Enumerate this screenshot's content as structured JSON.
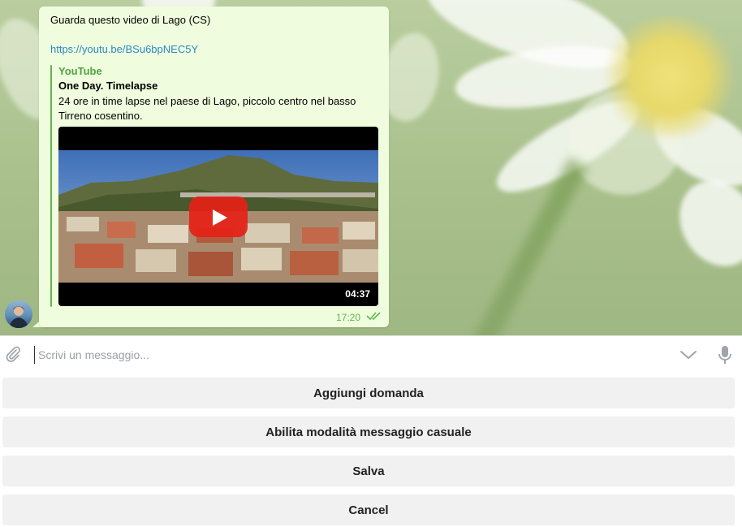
{
  "message": {
    "text": "Guarda questo video di Lago (CS)",
    "link": "https://youtu.be/BSu6bpNEC5Y",
    "preview": {
      "site_name": "YouTube",
      "title": "One Day. Timelapse",
      "description": "24 ore in time lapse nel paese di Lago, piccolo centro nel basso Tirreno cosentino.",
      "video_duration": "04:37"
    },
    "time": "17:20",
    "status": "read"
  },
  "input": {
    "placeholder": "Scrivi un messaggio..."
  },
  "keyboard": {
    "buttons": [
      "Aggiungi domanda",
      "Abilita modalità messaggio casuale",
      "Salva",
      "Cancel"
    ]
  },
  "icons": {
    "attach": "paperclip-icon",
    "keyboard_toggle": "chevron-down-icon",
    "voice": "microphone-icon",
    "read_status": "double-check-icon",
    "play": "play-icon"
  },
  "colors": {
    "bubble": "#effdde",
    "accent_green": "#5fb84c",
    "link_blue": "#2a88c7",
    "youtube_red": "#e62117",
    "button_bg": "#f1f1f1"
  }
}
